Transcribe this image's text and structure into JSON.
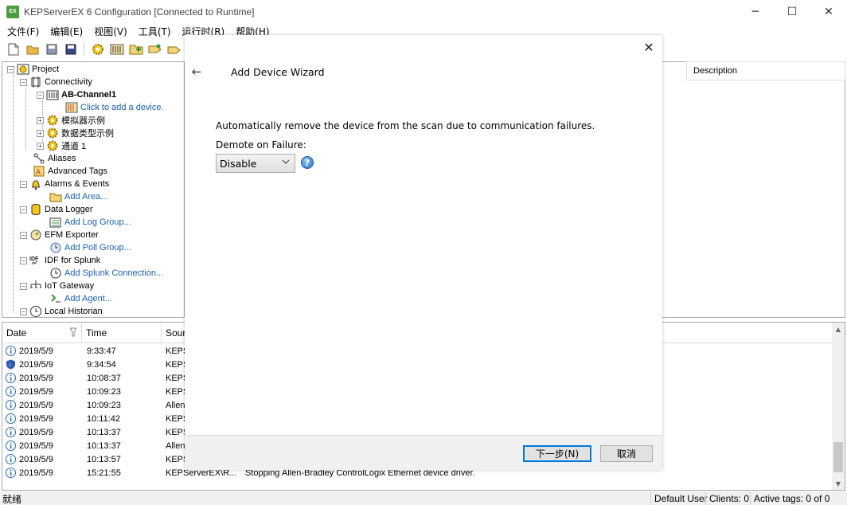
{
  "window": {
    "title": "KEPServerEX 6 Configuration [Connected to Runtime]",
    "logo_text": "EX",
    "controls": {
      "minimize": "─",
      "maximize": "☐",
      "close": "✕"
    }
  },
  "menu": [
    "文件(F)",
    "编辑(E)",
    "视图(V)",
    "工具(T)",
    "运行时(R)",
    "帮助(H)"
  ],
  "tree": {
    "project": "Project",
    "connectivity": "Connectivity",
    "channel": "AB-Channel1",
    "add_device": "Click to add a device.",
    "sim": "模拟器示例",
    "datatypes": "数据类型示例",
    "channel1": "通道 1",
    "aliases": "Aliases",
    "advanced_tags": "Advanced Tags",
    "alarms": "Alarms & Events",
    "add_area": "Add Area...",
    "data_logger": "Data Logger",
    "add_log_group": "Add Log Group...",
    "efm": "EFM Exporter",
    "add_poll_group": "Add Poll Group...",
    "idf": "IDF for Splunk",
    "add_splunk": "Add Splunk Connection...",
    "iot": "IoT Gateway",
    "add_agent": "Add Agent...",
    "local_historian": "Local Historian"
  },
  "right_header": "Description",
  "log": {
    "columns": {
      "date": "Date",
      "time": "Time",
      "source": "Sourc"
    },
    "rows": [
      {
        "date": "2019/5/9",
        "time": "9:33:47",
        "source": "KEPS",
        "event": "",
        "icon": "info"
      },
      {
        "date": "2019/5/9",
        "time": "9:34:54",
        "source": "KEPS",
        "event": "",
        "icon": "security"
      },
      {
        "date": "2019/5/9",
        "time": "10:08:37",
        "source": "KEPS",
        "event": "",
        "icon": "info"
      },
      {
        "date": "2019/5/9",
        "time": "10:09:23",
        "source": "KEPS",
        "event": "",
        "icon": "info"
      },
      {
        "date": "2019/5/9",
        "time": "10:09:23",
        "source": "Allen-",
        "event": "",
        "icon": "info"
      },
      {
        "date": "2019/5/9",
        "time": "10:11:42",
        "source": "KEPS",
        "event": "",
        "icon": "info"
      },
      {
        "date": "2019/5/9",
        "time": "10:13:37",
        "source": "KEPS",
        "event": "",
        "icon": "info"
      },
      {
        "date": "2019/5/9",
        "time": "10:13:37",
        "source": "Allen-",
        "event": "",
        "icon": "info"
      },
      {
        "date": "2019/5/9",
        "time": "10:13:57",
        "source": "KEPS",
        "event": "",
        "icon": "info"
      },
      {
        "date": "2019/5/9",
        "time": "15:21:55",
        "source": "KEPServerEX\\R...",
        "event": "Stopping Allen-Bradley ControlLogix Ethernet device driver.",
        "icon": "info"
      }
    ]
  },
  "status": {
    "left": "就绪",
    "user": "Default User",
    "clients": "Clients: 0",
    "active_tags": "Active tags: 0 of 0"
  },
  "wizard": {
    "title": "Add Device Wizard",
    "description": "Automatically remove the device from the scan due to communication failures.",
    "field_label": "Demote on Failure:",
    "selected_value": "Disable",
    "next_button": "下一步(N)",
    "cancel_button": "取消",
    "help_glyph": "?",
    "back_glyph": "←",
    "close_glyph": "✕"
  }
}
